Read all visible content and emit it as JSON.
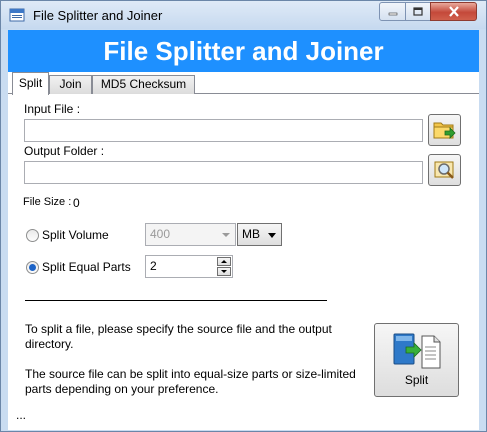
{
  "window": {
    "title": "File Splitter and Joiner"
  },
  "banner": {
    "title": "File Splitter and Joiner",
    "background": "#1e90ff"
  },
  "tabs": [
    {
      "label": "Split",
      "active": true
    },
    {
      "label": "Join",
      "active": false
    },
    {
      "label": "MD5 Checksum",
      "active": false
    }
  ],
  "split": {
    "input_file_label": "Input File :",
    "input_file_value": "",
    "output_folder_label": "Output Folder :",
    "output_folder_value": "",
    "file_size_label": "File Size :",
    "file_size_value": "0",
    "split_volume_label": "Split Volume",
    "split_volume_value": "400",
    "split_volume_unit": "MB",
    "split_volume_selected": false,
    "split_equal_label": "Split Equal Parts",
    "split_equal_value": "2",
    "split_equal_selected": true,
    "info_line1": "To split a file, please specify the source file and the output directory.",
    "info_line2": "The source file can be split into equal-size parts or size-limited parts depending on your preference.",
    "status": "...",
    "split_button_label": "Split"
  },
  "icons": {
    "app": "window-app-icon",
    "browse_input": "folder-open-arrow-icon",
    "browse_output": "folder-search-icon",
    "split": "split-file-icon"
  }
}
